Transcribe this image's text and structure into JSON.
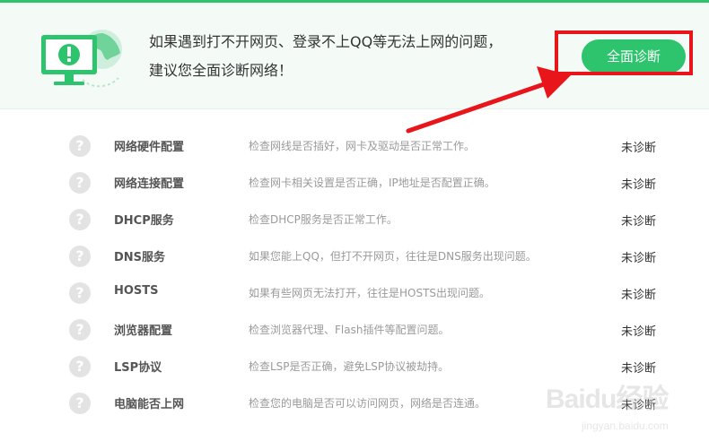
{
  "banner": {
    "line1": "如果遇到打不开网页、登录不上QQ等无法上网的问题，",
    "line2": "建议您全面诊断网络！",
    "button_label": "全面诊断",
    "icon": "computer-globe-warning-icon"
  },
  "items": [
    {
      "name": "网络硬件配置",
      "desc": "检查网线是否插好，网卡及驱动是否正常工作。",
      "status": "未诊断",
      "icon": "question-icon"
    },
    {
      "name": "网络连接配置",
      "desc": "检查网卡相关设置是否正确，IP地址是否配置正确。",
      "status": "未诊断",
      "icon": "question-icon"
    },
    {
      "name": "DHCP服务",
      "desc": "检查DHCP服务是否正常工作。",
      "status": "未诊断",
      "icon": "question-icon"
    },
    {
      "name": "DNS服务",
      "desc": "如果您能上QQ，但打不开网页，往往是DNS服务出现问题。",
      "status": "未诊断",
      "icon": "question-icon"
    },
    {
      "name": "HOSTS",
      "desc": "如果有些网页无法打开，往往是HOSTS出现问题。",
      "status": "未诊断",
      "icon": "question-icon"
    },
    {
      "name": "浏览器配置",
      "desc": "检查浏览器代理、Flash插件等配置问题。",
      "status": "未诊断",
      "icon": "question-icon"
    },
    {
      "name": "LSP协议",
      "desc": "检查LSP是否正确，避免LSP协议被劫持。",
      "status": "未诊断",
      "icon": "question-icon"
    },
    {
      "name": "电脑能否上网",
      "desc": "检查您的电脑是否可以访问网页，网络是否连通。",
      "status": "未诊断",
      "icon": "question-icon"
    }
  ],
  "watermark": {
    "main": "Baidu经验",
    "sub": "jingyan.baidu.com"
  },
  "colors": {
    "accent": "#2dc46d",
    "annotation": "#e8151b",
    "banner_bg": "#f4fbf7"
  }
}
